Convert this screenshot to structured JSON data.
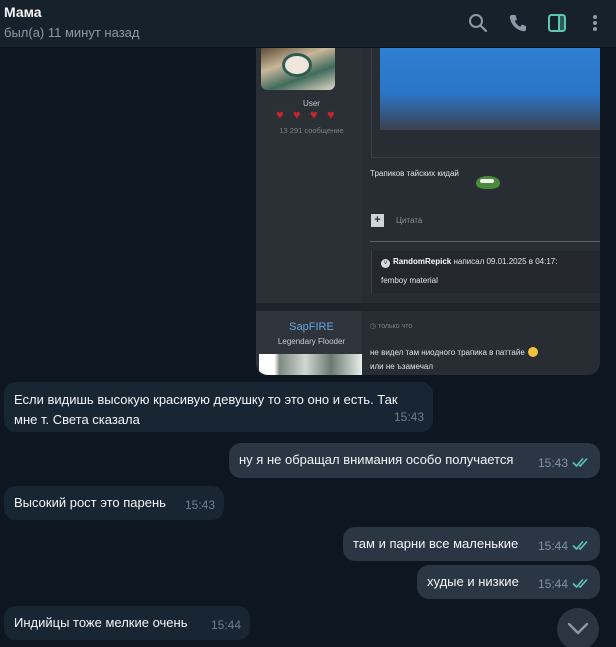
{
  "header": {
    "contact_name": "Мама",
    "status": "был(а) 11 минут назад",
    "icons": [
      "search-icon",
      "phone-icon",
      "sidebar-icon",
      "more-icon"
    ],
    "accent_color": "#5cc8b0"
  },
  "forum_screenshot": {
    "user_role": "User",
    "message_count": "13 291 сообщение",
    "post_text": "Трапиков тайских кидай",
    "quote_label": "Цитата",
    "quote_author": "RandomRepick",
    "quote_meta": "написал 09.01.2025 в 04:17:",
    "quote_body": "femboy material",
    "second_user": "SapFIRE",
    "second_role": "Legendary Flooder",
    "second_time": "только что",
    "second_line1": "не видел там ниодного трапика в паттайе",
    "second_line2": "или не ъзамечал"
  },
  "messages": [
    {
      "dir": "in",
      "text_line1": "Если видишь высокую красивую девушку то это оно и есть. Так",
      "text_line2": "мне т. Света сказала",
      "time": "15:43"
    },
    {
      "dir": "out",
      "text": "ну я не обращал внимания особо получается",
      "time": "15:43"
    },
    {
      "dir": "in",
      "text": "Высокий рост это парень",
      "time": "15:43"
    },
    {
      "dir": "out",
      "text": "там и парни все маленькие",
      "time": "15:44"
    },
    {
      "dir": "out",
      "text": "худые и низкие",
      "time": "15:44"
    },
    {
      "dir": "in",
      "text": "Индийцы тоже мелкие очень",
      "time": "15:44"
    }
  ]
}
